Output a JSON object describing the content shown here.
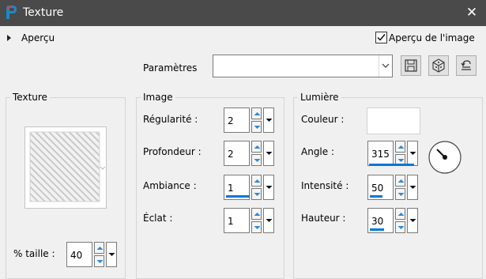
{
  "window": {
    "title": "Texture",
    "close_glyph": "✕",
    "app_icon": "paintshop-icon"
  },
  "apercu": {
    "label": "Aperçu",
    "checkbox_label": "Aperçu de l'image",
    "checked": true
  },
  "parametres": {
    "label": "Paramètres",
    "value": ""
  },
  "texture_group": {
    "title": "Texture",
    "taille_label": "% taille :",
    "taille_value": "40"
  },
  "image_group": {
    "title": "Image",
    "regularite_label": "Régularité :",
    "regularite_value": "2",
    "profondeur_label": "Profondeur :",
    "profondeur_value": "2",
    "ambiance_label": "Ambiance :",
    "ambiance_value": "1",
    "eclat_label": "Éclat :",
    "eclat_value": "1"
  },
  "lumiere_group": {
    "title": "Lumière",
    "couleur_label": "Couleur :",
    "couleur_value": "#ffffff",
    "angle_label": "Angle :",
    "angle_value": "315",
    "intensite_label": "Intensité :",
    "intensite_value": "50",
    "hauteur_label": "Hauteur :",
    "hauteur_value": "30"
  },
  "colors": {
    "titlebar": "#4a4a4a",
    "accent": "#0078d7",
    "window_bg": "#f0f0f0"
  }
}
